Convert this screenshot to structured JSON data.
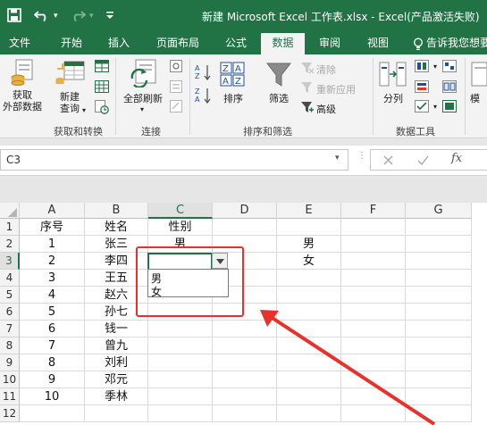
{
  "title_bar": {
    "title": "新建 Microsoft Excel 工作表.xlsx - Excel(产品激活失败)"
  },
  "tabs": [
    "文件",
    "开始",
    "插入",
    "页面布局",
    "公式",
    "数据",
    "审阅",
    "视图",
    "告诉我您想要做"
  ],
  "active_tab": "数据",
  "ribbon": {
    "get_external_data": "获取\n外部数据",
    "new_query": "新建\n查询",
    "group_get_transform": "获取和转换",
    "refresh_all": "全部刷新",
    "group_connections": "连接",
    "sort": "排序",
    "filter": "筛选",
    "clear": "清除",
    "reapply": "重新应用",
    "advanced": "高级",
    "group_sort_filter": "排序和筛选",
    "text_to_columns": "分列",
    "group_data_tools": "数据工具",
    "model_partial": "模"
  },
  "formula_bar": {
    "name_box": "C3",
    "fx": "fx",
    "content": ""
  },
  "grid": {
    "columns": [
      "A",
      "B",
      "C",
      "D",
      "E",
      "F",
      "G"
    ],
    "rows": [
      "1",
      "2",
      "3",
      "4",
      "5",
      "6",
      "7",
      "8",
      "9",
      "10",
      "11",
      "12"
    ],
    "selected_column": "C",
    "selected_row": "3",
    "header_row": [
      "序号",
      "姓名",
      "性别",
      "",
      "",
      "",
      ""
    ],
    "data_rows": [
      [
        "1",
        "张三",
        "男",
        "",
        "男",
        "",
        ""
      ],
      [
        "2",
        "李四",
        "",
        "",
        "女",
        "",
        ""
      ],
      [
        "3",
        "王五",
        "",
        "",
        "",
        "",
        ""
      ],
      [
        "4",
        "赵六",
        "",
        "",
        "",
        "",
        ""
      ],
      [
        "5",
        "孙七",
        "",
        "",
        "",
        "",
        ""
      ],
      [
        "6",
        "钱一",
        "",
        "",
        "",
        "",
        ""
      ],
      [
        "7",
        "曾九",
        "",
        "",
        "",
        "",
        ""
      ],
      [
        "8",
        "刘利",
        "",
        "",
        "",
        "",
        ""
      ],
      [
        "9",
        "邓元",
        "",
        "",
        "",
        "",
        ""
      ],
      [
        "10",
        "季林",
        "",
        "",
        "",
        "",
        ""
      ],
      [
        "",
        "",
        "",
        "",
        "",
        "",
        ""
      ]
    ]
  },
  "dropdown": {
    "options": [
      "男",
      "女"
    ]
  },
  "colors": {
    "excel_green": "#217346",
    "annotation_red": "#e8312b"
  }
}
